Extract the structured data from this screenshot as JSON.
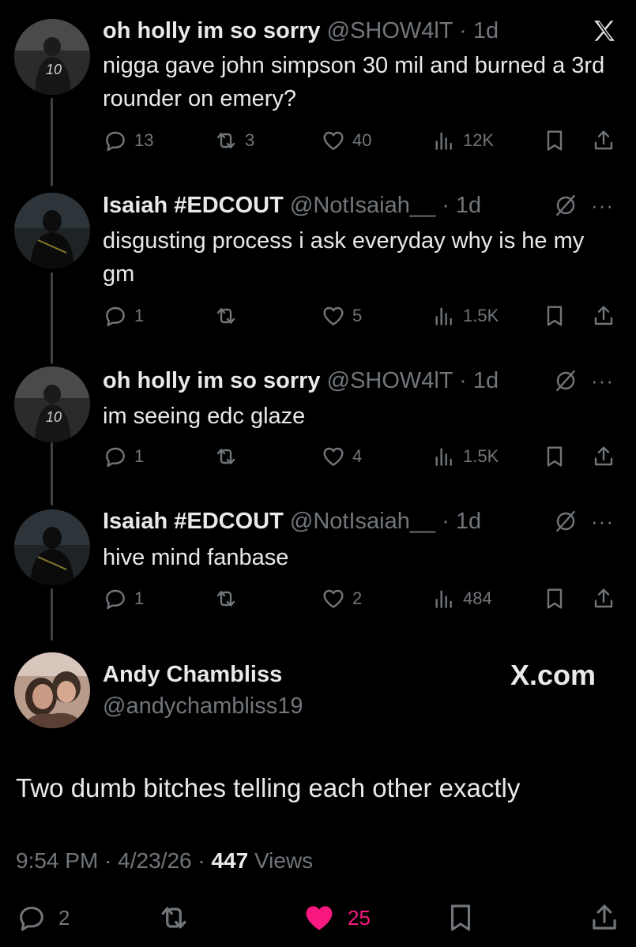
{
  "tweets": [
    {
      "name": "oh holly im so sorry",
      "handle": "@SHOW4lT",
      "time": "1d",
      "text": "nigga gave john simpson 30 mil and burned a 3rd rounder on emery?",
      "replies": "13",
      "retweets": "3",
      "likes": "40",
      "views": "12K",
      "top_right_icon": "x-logo-icon"
    },
    {
      "name": "Isaiah #EDCOUT",
      "handle": "@NotIsaiah__",
      "time": "1d",
      "text": "disgusting process i ask everyday why is he my gm",
      "replies": "1",
      "retweets": "",
      "likes": "5",
      "views": "1.5K",
      "top_right_icon": "grok-icon"
    },
    {
      "name": "oh holly im so sorry",
      "handle": "@SHOW4lT",
      "time": "1d",
      "text": "im seeing edc glaze",
      "replies": "1",
      "retweets": "",
      "likes": "4",
      "views": "1.5K",
      "top_right_icon": "grok-icon"
    },
    {
      "name": "Isaiah #EDCOUT",
      "handle": "@NotIsaiah__",
      "time": "1d",
      "text": "hive mind fanbase",
      "replies": "1",
      "retweets": "",
      "likes": "2",
      "views": "484",
      "top_right_icon": "grok-icon"
    }
  ],
  "dot": "·",
  "more_label": "···",
  "main_tweet": {
    "name": "Andy Chambliss",
    "handle": "@andychambliss19",
    "brand": "X.com",
    "text": "Two dumb bitches telling each other exactly",
    "time": "9:54 PM",
    "date": "4/23/26",
    "views_count": "447",
    "views_label": "Views",
    "replies": "2",
    "likes": "25"
  },
  "colors": {
    "background": "#000000",
    "text_primary": "#e7e9ea",
    "text_secondary": "#71767b",
    "like_active": "#f91880",
    "thread_line": "#3e4144"
  }
}
